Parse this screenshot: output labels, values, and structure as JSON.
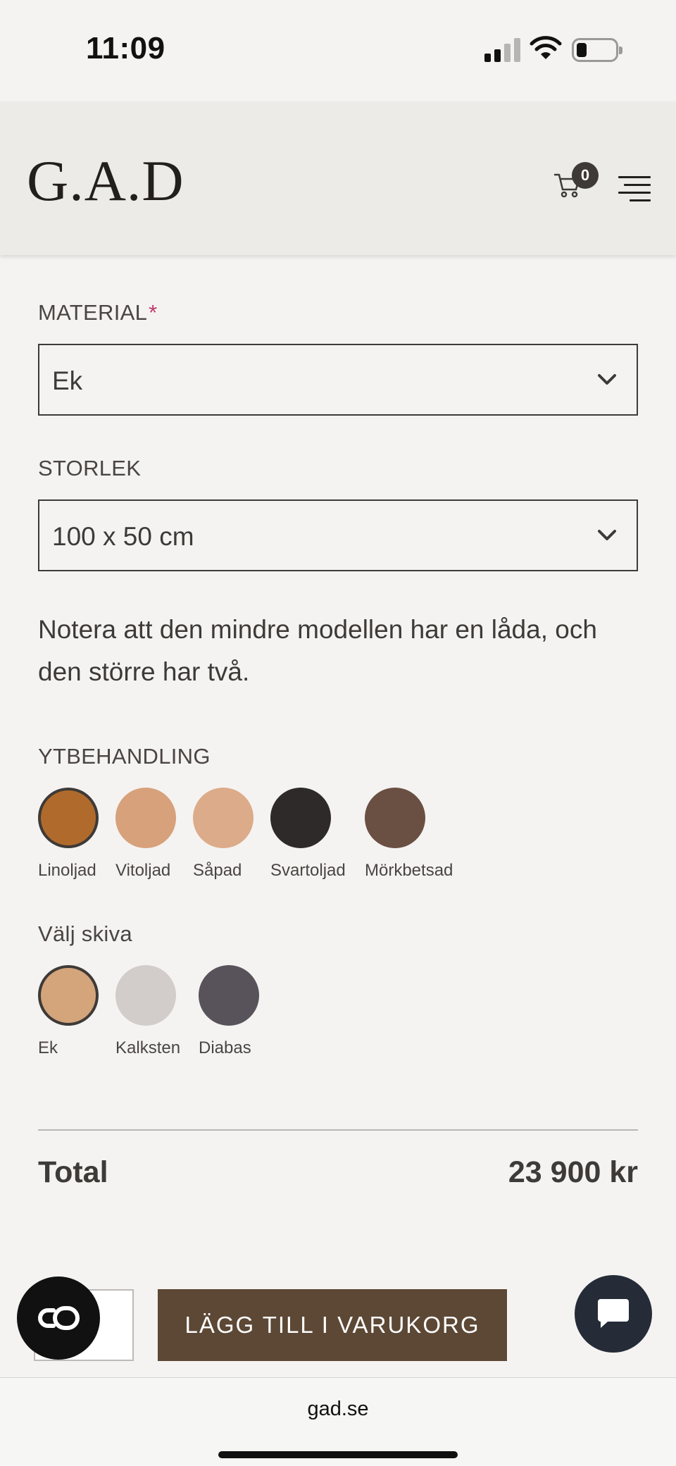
{
  "status_bar": {
    "time": "11:09",
    "icons": [
      "signal-icon",
      "wifi-icon",
      "battery-icon"
    ]
  },
  "header": {
    "logo": "G.A.D",
    "cart_count": "0",
    "icons": [
      "cart-icon",
      "menu-icon"
    ]
  },
  "form": {
    "material": {
      "label": "MATERIAL",
      "required_mark": "*",
      "value": "Ek"
    },
    "size": {
      "label": "STORLEK",
      "value": "100 x 50 cm"
    },
    "note": "Notera att den mindre modellen har en låda, och den större har två."
  },
  "finish": {
    "label": "YTBEHANDLING",
    "options": [
      {
        "label": "Linoljad",
        "color": "#b06b2c",
        "selected": true
      },
      {
        "label": "Vitoljad",
        "color": "#d7a17b",
        "selected": false
      },
      {
        "label": "Såpad",
        "color": "#dcab89",
        "selected": false
      },
      {
        "label": "Svartoljad",
        "color": "#2f2a2a",
        "selected": false
      },
      {
        "label": "Mörkbetsad",
        "color": "#6a4f43",
        "selected": false
      }
    ]
  },
  "top": {
    "label": "Välj skiva",
    "options": [
      {
        "label": "Ek",
        "color": "#d4a47b",
        "selected": true
      },
      {
        "label": "Kalksten",
        "color": "#d2cccb",
        "selected": false
      },
      {
        "label": "Diabas",
        "color": "#58525a",
        "selected": false
      }
    ]
  },
  "total": {
    "label": "Total",
    "price": "23 900 kr"
  },
  "actions": {
    "quantity_value": "",
    "add_to_cart_label": "LÄGG TILL I VARUKORG",
    "accessibility_icon": "accessibility-icon",
    "chat_icon": "chat-icon"
  },
  "browser": {
    "url": "gad.se"
  },
  "colors": {
    "background": "#f5f3f1",
    "header_bg": "#ecebe8",
    "text": "#3e3a37",
    "button_brown": "#5c4835",
    "required": "#c0396b",
    "chat_button": "#252c38"
  }
}
